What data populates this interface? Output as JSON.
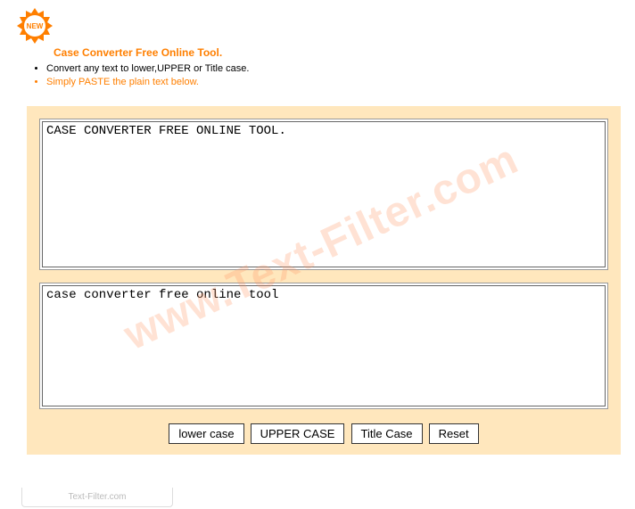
{
  "badge": {
    "label": "NEW"
  },
  "title": "Case Converter Free Online Tool.",
  "description": [
    "Convert any text to lower,UPPER or Title case.",
    "Simply PASTE the plain text below."
  ],
  "textarea_input": "CASE CONVERTER FREE ONLINE TOOL.",
  "textarea_output": "case converter free online tool",
  "buttons": {
    "lower": "lower case",
    "upper": "UPPER CASE",
    "title": "Title Case",
    "reset": "Reset"
  },
  "watermark": "www.Text-Filter.com",
  "footer": "Text-Filter.com"
}
